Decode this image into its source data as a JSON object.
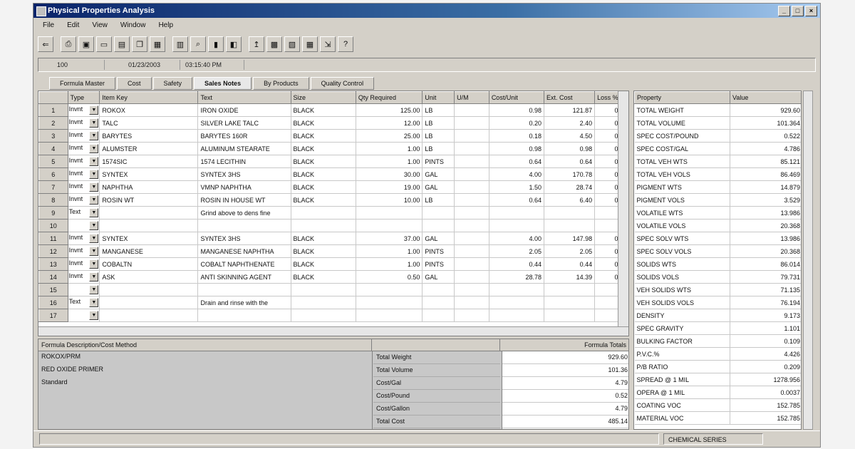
{
  "window": {
    "title": "Physical Properties Analysis"
  },
  "menu": [
    "File",
    "Edit",
    "View",
    "Window",
    "Help"
  ],
  "toolbar_icons": [
    "exit-icon",
    "print-icon",
    "save-icon",
    "new-icon",
    "open-icon",
    "copy-icon",
    "paste-icon",
    "calc-icon",
    "find-icon",
    "doc-icon",
    "cost-icon",
    "up-icon",
    "report-icon",
    "chart-icon",
    "grid-icon",
    "export-icon",
    "help-icon"
  ],
  "infobar": {
    "code": "100",
    "date": "01/23/2003",
    "time": "03:15:40 PM"
  },
  "tabs": [
    {
      "label": "Formula Master",
      "active": false
    },
    {
      "label": "Cost",
      "active": false
    },
    {
      "label": "Safety",
      "active": false
    },
    {
      "label": "Sales Notes",
      "active": true
    },
    {
      "label": "By Products",
      "active": false
    },
    {
      "label": "Quality Control",
      "active": false
    }
  ],
  "grid": {
    "headers": [
      "",
      "Type",
      "Item Key",
      "Text",
      "Size",
      "Qty Required",
      "Unit",
      "U/M",
      "Cost/Unit",
      "Ext. Cost",
      "Loss %"
    ],
    "rows": [
      {
        "n": "1",
        "type": "Invnt",
        "key": "ROKOX",
        "text": "IRON OXIDE",
        "size": "BLACK",
        "qty": "125.00",
        "unit": "LB",
        "um": "",
        "cost": "0.98",
        "ext": "121.87",
        "loss": "0.00"
      },
      {
        "n": "2",
        "type": "Invnt",
        "key": "TALC",
        "text": "SILVER LAKE TALC",
        "size": "BLACK",
        "qty": "12.00",
        "unit": "LB",
        "um": "",
        "cost": "0.20",
        "ext": "2.40",
        "loss": "0.00"
      },
      {
        "n": "3",
        "type": "Invnt",
        "key": "BARYTES",
        "text": "BARYTES 160R",
        "size": "BLACK",
        "qty": "25.00",
        "unit": "LB",
        "um": "",
        "cost": "0.18",
        "ext": "4.50",
        "loss": "0.00"
      },
      {
        "n": "4",
        "type": "Invnt",
        "key": "ALUMSTER",
        "text": "ALUMINUM STEARATE",
        "size": "BLACK",
        "qty": "1.00",
        "unit": "LB",
        "um": "",
        "cost": "0.98",
        "ext": "0.98",
        "loss": "0.00"
      },
      {
        "n": "5",
        "type": "Invnt",
        "key": "1574SIC",
        "text": "1574 LECITHIN",
        "size": "BLACK",
        "qty": "1.00",
        "unit": "PINTS",
        "um": "",
        "cost": "0.64",
        "ext": "0.64",
        "loss": "0.00"
      },
      {
        "n": "6",
        "type": "Invnt",
        "key": "SYNTEX",
        "text": "SYNTEX 3HS",
        "size": "BLACK",
        "qty": "30.00",
        "unit": "GAL",
        "um": "",
        "cost": "4.00",
        "ext": "170.78",
        "loss": "0.00"
      },
      {
        "n": "7",
        "type": "Invnt",
        "key": "NAPHTHA",
        "text": "VMNP NAPHTHA",
        "size": "BLACK",
        "qty": "19.00",
        "unit": "GAL",
        "um": "",
        "cost": "1.50",
        "ext": "28.74",
        "loss": "0.00"
      },
      {
        "n": "8",
        "type": "Invnt",
        "key": "ROSIN WT",
        "text": "ROSIN IN HOUSE WT",
        "size": "BLACK",
        "qty": "10.00",
        "unit": "LB",
        "um": "",
        "cost": "0.64",
        "ext": "6.40",
        "loss": "0.00"
      },
      {
        "n": "9",
        "type": "Text",
        "key": "",
        "text": "Grind above to dens fine",
        "size": "",
        "qty": "",
        "unit": "",
        "um": "",
        "cost": "",
        "ext": "",
        "loss": ""
      },
      {
        "n": "10",
        "type": "",
        "key": "",
        "text": "",
        "size": "",
        "qty": "",
        "unit": "",
        "um": "",
        "cost": "",
        "ext": "",
        "loss": ""
      },
      {
        "n": "11",
        "type": "Invnt",
        "key": "SYNTEX",
        "text": "SYNTEX 3HS",
        "size": "BLACK",
        "qty": "37.00",
        "unit": "GAL",
        "um": "",
        "cost": "4.00",
        "ext": "147.98",
        "loss": "0.00"
      },
      {
        "n": "12",
        "type": "Invnt",
        "key": "MANGANESE",
        "text": "MANGANESE NAPHTHA",
        "size": "BLACK",
        "qty": "1.00",
        "unit": "PINTS",
        "um": "",
        "cost": "2.05",
        "ext": "2.05",
        "loss": "0.00"
      },
      {
        "n": "13",
        "type": "Invnt",
        "key": "COBALTN",
        "text": "COBALT NAPHTHENATE",
        "size": "BLACK",
        "qty": "1.00",
        "unit": "PINTS",
        "um": "",
        "cost": "0.44",
        "ext": "0.44",
        "loss": "0.00"
      },
      {
        "n": "14",
        "type": "Invnt",
        "key": "ASK",
        "text": "ANTI SKINNING AGENT",
        "size": "BLACK",
        "qty": "0.50",
        "unit": "GAL",
        "um": "",
        "cost": "28.78",
        "ext": "14.39",
        "loss": "0.00"
      },
      {
        "n": "15",
        "type": "",
        "key": "",
        "text": "",
        "size": "",
        "qty": "",
        "unit": "",
        "um": "",
        "cost": "",
        "ext": "",
        "loss": ""
      },
      {
        "n": "16",
        "type": "Text",
        "key": "",
        "text": "Drain and rinse with the",
        "size": "",
        "qty": "",
        "unit": "",
        "um": "",
        "cost": "",
        "ext": "",
        "loss": ""
      },
      {
        "n": "17",
        "type": "",
        "key": "",
        "text": "",
        "size": "",
        "qty": "",
        "unit": "",
        "um": "",
        "cost": "",
        "ext": "",
        "loss": ""
      }
    ]
  },
  "properties": {
    "headers": [
      "Property",
      "Value"
    ],
    "rows": [
      {
        "p": "TOTAL WEIGHT",
        "v": "929.60"
      },
      {
        "p": "TOTAL VOLUME",
        "v": "101.364"
      },
      {
        "p": "SPEC COST/POUND",
        "v": "0.522"
      },
      {
        "p": "SPEC COST/GAL",
        "v": "4.786"
      },
      {
        "p": "TOTAL VEH WTS",
        "v": "85.121"
      },
      {
        "p": "TOTAL VEH VOLS",
        "v": "86.469"
      },
      {
        "p": "PIGMENT WTS",
        "v": "14.879"
      },
      {
        "p": "PIGMENT VOLS",
        "v": "3.529"
      },
      {
        "p": "VOLATILE WTS",
        "v": "13.986"
      },
      {
        "p": "VOLATILE VOLS",
        "v": "20.368"
      },
      {
        "p": "SPEC SOLV WTS",
        "v": "13.986"
      },
      {
        "p": "SPEC SOLV VOLS",
        "v": "20.368"
      },
      {
        "p": "SOLIDS WTS",
        "v": "86.014"
      },
      {
        "p": "SOLIDS VOLS",
        "v": "79.731"
      },
      {
        "p": "VEH SOLIDS WTS",
        "v": "71.135"
      },
      {
        "p": "VEH SOLIDS VOLS",
        "v": "76.194"
      },
      {
        "p": "DENSITY",
        "v": "9.173"
      },
      {
        "p": "SPEC GRAVITY",
        "v": "1.101"
      },
      {
        "p": "BULKING FACTOR",
        "v": "0.109"
      },
      {
        "p": "P.V.C.%",
        "v": "4.426"
      },
      {
        "p": "P/B RATIO",
        "v": "0.209"
      },
      {
        "p": "SPREAD @ 1 MIL",
        "v": "1278.956"
      },
      {
        "p": "OPERA @ 1 MIL",
        "v": "0.0037"
      },
      {
        "p": "COATING VOC",
        "v": "152.785"
      },
      {
        "p": "MATERIAL VOC",
        "v": "152.785"
      }
    ]
  },
  "formula": {
    "headers": [
      "Formula Description/Cost Method",
      "",
      "Formula Totals"
    ],
    "description": [
      "ROKOX/PRM",
      "RED OXIDE PRIMER",
      "Standard"
    ],
    "total_labels": [
      "Total Weight",
      "Total Volume",
      "Cost/Gal",
      "Cost/Pound",
      "Cost/Gallon",
      "Total Cost"
    ],
    "total_values": [
      "929.60",
      "101.36",
      "4.79",
      "0.52",
      "4.79",
      "485.14"
    ]
  },
  "status": {
    "right": "CHEMICAL SERIES"
  }
}
